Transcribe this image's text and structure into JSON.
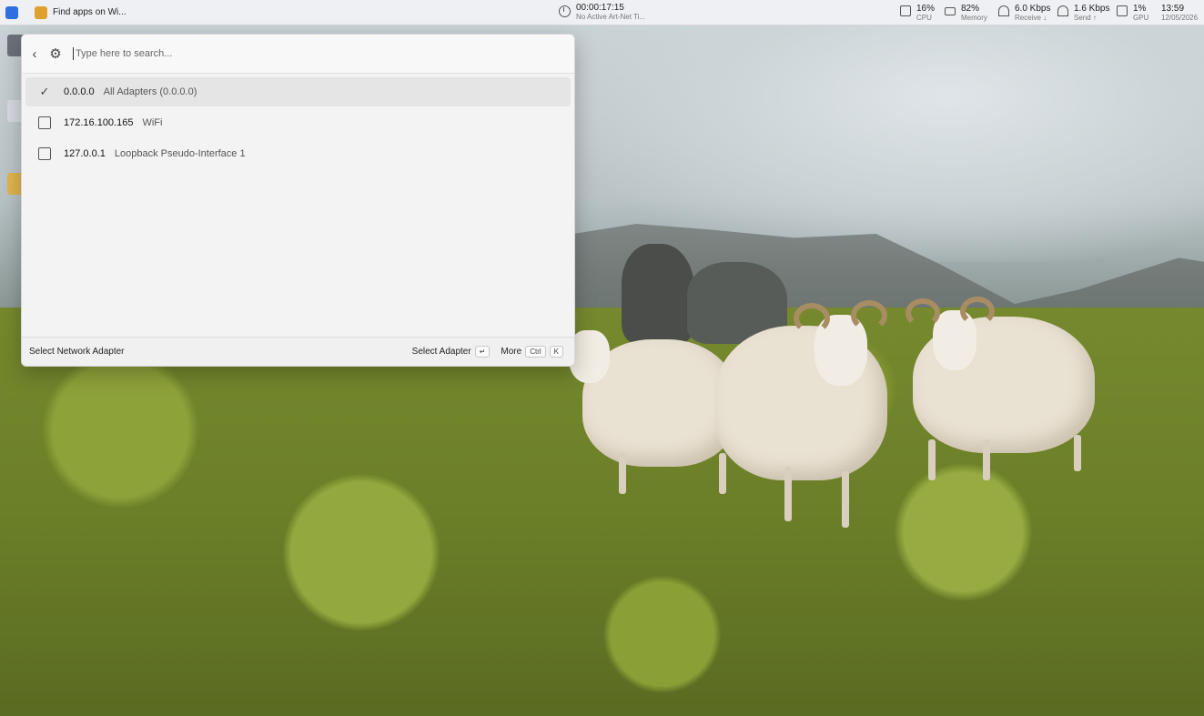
{
  "taskbar": {
    "apps": [
      {
        "icon": "lightning-app-icon",
        "label": "",
        "color": "#2f6fe0"
      },
      {
        "icon": "store-app-icon",
        "label": "Find apps on Wi...",
        "color": "#e0a030"
      }
    ],
    "timer": {
      "value": "00:00:17:15",
      "sub": "No Active Art-Net Ti..."
    },
    "stats": {
      "cpu": {
        "value": "16%",
        "label": "CPU"
      },
      "memory": {
        "value": "82%",
        "label": "Memory"
      },
      "receive": {
        "value": "6.0 Kbps",
        "label": "Receive ↓"
      },
      "send": {
        "value": "1.6 Kbps",
        "label": "Send ↑"
      },
      "gpu": {
        "value": "1%",
        "label": "GPU"
      }
    },
    "clock": {
      "time": "13:59",
      "date": "12/05/2026"
    }
  },
  "launcher": {
    "search": {
      "placeholder": "Type here to search..."
    },
    "adapters": [
      {
        "address": "0.0.0.0",
        "name": "All Adapters (0.0.0.0)",
        "checked": true
      },
      {
        "address": "172.16.100.165",
        "name": "WiFi",
        "checked": false
      },
      {
        "address": "127.0.0.1",
        "name": "Loopback Pseudo-Interface 1",
        "checked": false
      }
    ],
    "footer": {
      "title": "Select Network Adapter",
      "select_label": "Select Adapter",
      "select_key": "↵",
      "more_label": "More",
      "more_key1": "Ctrl",
      "more_key2": "K"
    }
  }
}
